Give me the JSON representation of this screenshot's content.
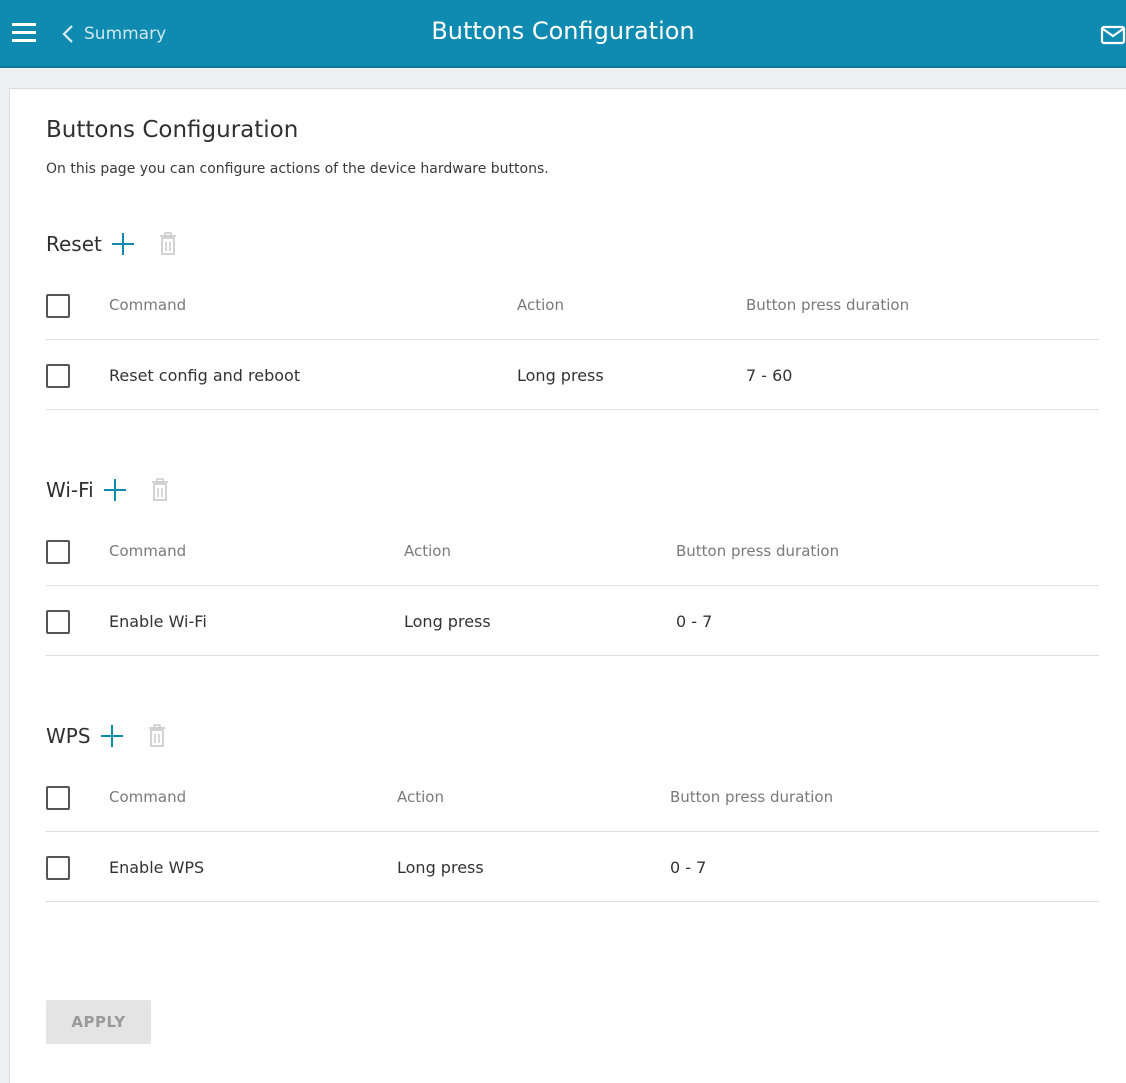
{
  "header": {
    "back_label": "Summary",
    "title": "Buttons Configuration",
    "accent_color": "#0f8ab0",
    "icons": [
      "menu-icon",
      "chevron-left-icon",
      "mail-icon"
    ]
  },
  "page": {
    "title": "Buttons Configuration",
    "description": "On this page you can configure actions of the device hardware buttons."
  },
  "columns": {
    "command": "Command",
    "action": "Action",
    "duration": "Button press duration"
  },
  "sections": [
    {
      "title": "Reset",
      "rows": [
        {
          "command": "Reset config and reboot",
          "action": "Long press",
          "duration": "7 - 60"
        }
      ]
    },
    {
      "title": "Wi-Fi",
      "rows": [
        {
          "command": "Enable Wi-Fi",
          "action": "Long press",
          "duration": "0 - 7"
        }
      ]
    },
    {
      "title": "WPS",
      "rows": [
        {
          "command": "Enable WPS",
          "action": "Long press",
          "duration": "0 - 7"
        }
      ]
    }
  ],
  "footer": {
    "apply_label": "APPLY"
  }
}
